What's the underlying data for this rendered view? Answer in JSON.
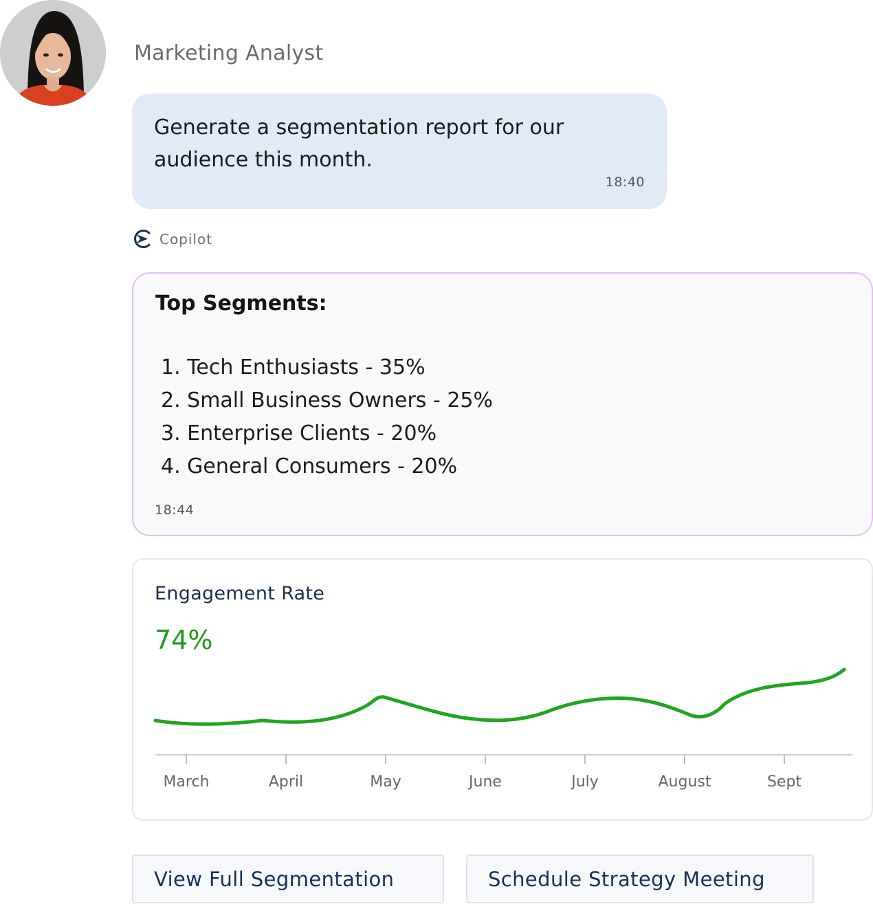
{
  "sender": {
    "name": "Marketing Analyst",
    "avatar_icon": "person-photo-avatar"
  },
  "user_message": {
    "text": "Generate a segmentation report for our audience this month.",
    "time": "18:40"
  },
  "copilot": {
    "label": "Copilot",
    "icon": "copilot-logo-icon"
  },
  "bot_message": {
    "heading": "Top Segments:",
    "segments": [
      "1. Tech Enthusiasts - 35%",
      "2. Small Business Owners - 25%",
      "3. Enterprise Clients - 20%",
      "4. General Consumers - 20%"
    ],
    "time": "18:44"
  },
  "engagement": {
    "title": "Engagement Rate",
    "value": "74%"
  },
  "chart_data": {
    "type": "line",
    "title": "Engagement Rate",
    "categories": [
      "March",
      "April",
      "May",
      "June",
      "July",
      "August",
      "Sept"
    ],
    "line_color": "#1fa51f",
    "grid": false,
    "legend": "none"
  },
  "actions": {
    "view_label": "View Full Segmentation",
    "schedule_label": "Schedule Strategy Meeting"
  },
  "colors": {
    "user_bubble": "#e2eaf8",
    "bot_border": "#e2bdf3",
    "accent_green": "#1d9a1d",
    "button_text": "#16305a"
  }
}
